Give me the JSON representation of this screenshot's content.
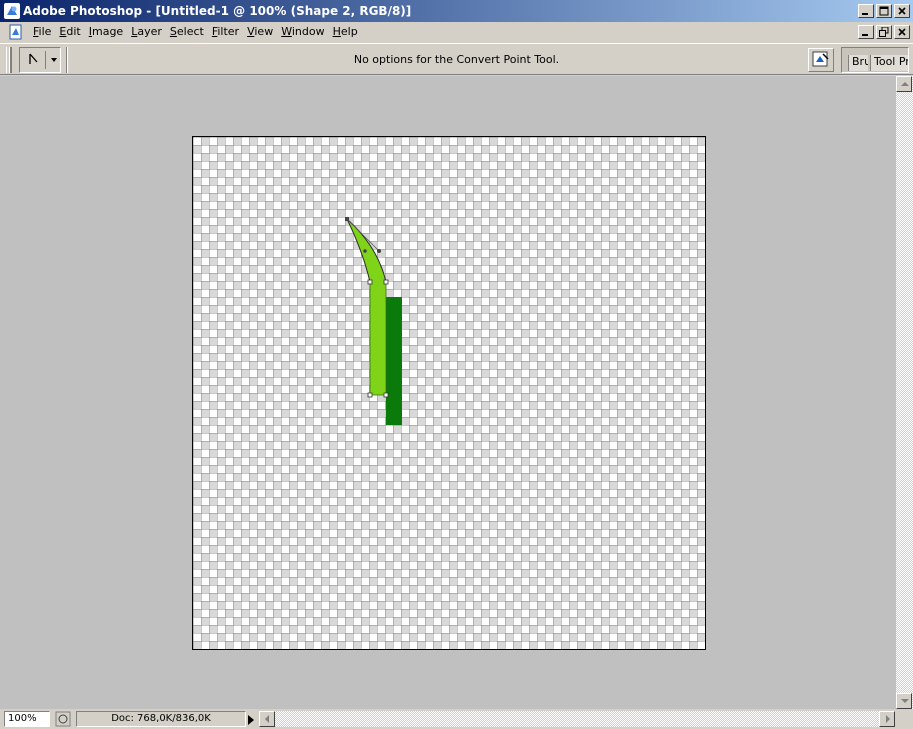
{
  "window": {
    "title": "Adobe Photoshop - [Untitled-1 @ 100% (Shape 2, RGB/8)]"
  },
  "menu": {
    "items": [
      "File",
      "Edit",
      "Image",
      "Layer",
      "Select",
      "Filter",
      "View",
      "Window",
      "Help"
    ]
  },
  "options": {
    "message": "No options for the Convert Point Tool.",
    "active_tool_icon": "convert-point-tool-icon"
  },
  "palette_well": {
    "tabs": [
      "Bru",
      "Tool Pr"
    ]
  },
  "status": {
    "zoom": "100%",
    "doc_info": "Doc: 768,0K/836,0K"
  },
  "colors": {
    "shape_light_green": "#7fd41a",
    "shape_dark_green": "#0a7a0a",
    "titlebar_start": "#0a246a",
    "workspace": "#c0c0c0"
  }
}
